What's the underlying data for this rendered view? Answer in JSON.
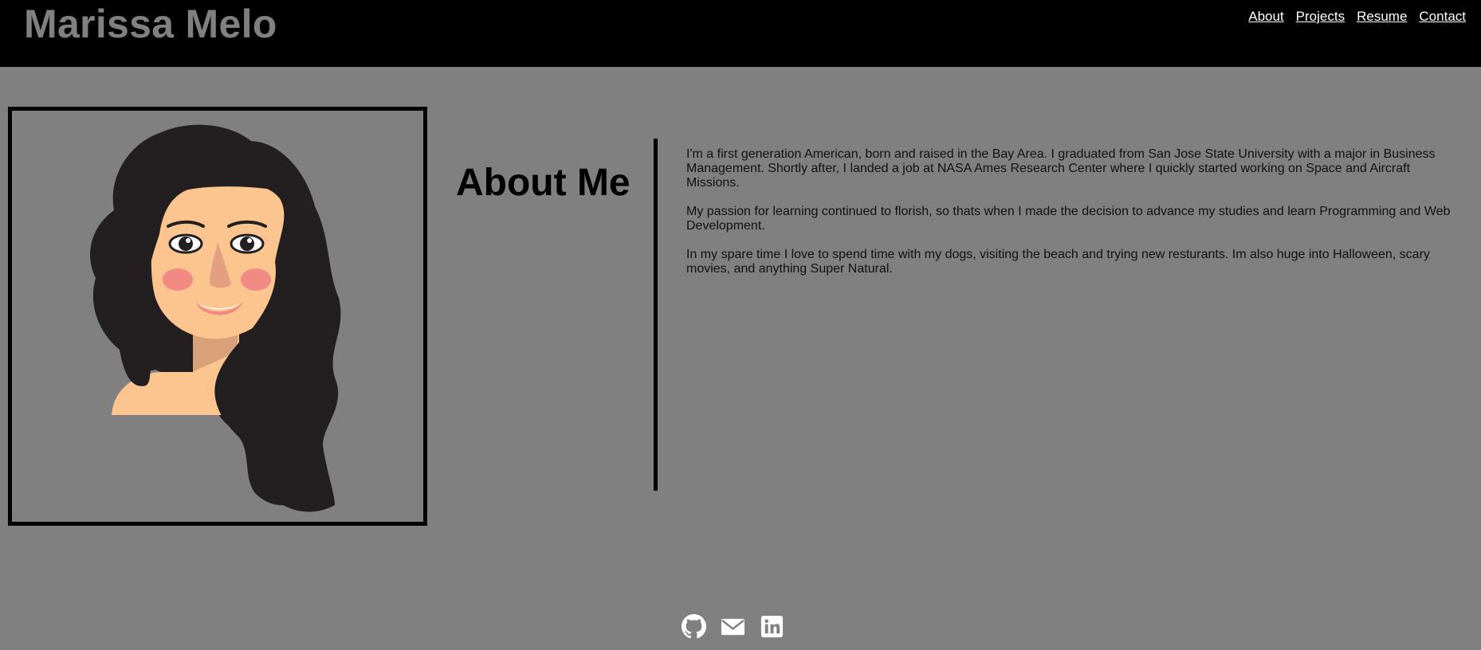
{
  "header": {
    "title": "Marissa Melo",
    "nav": [
      {
        "label": "About"
      },
      {
        "label": "Projects"
      },
      {
        "label": "Resume"
      },
      {
        "label": "Contact"
      }
    ]
  },
  "about": {
    "heading": "About Me",
    "paragraphs": [
      "I'm a first generation American, born and raised in the Bay Area. I graduated from San Jose State University with a major in Business Management. Shortly after, I landed a job at NASA Ames Research Center where I quickly started working on Space and Aircraft Missions.",
      "My passion for learning continued to florish, so thats when I made the decision to advance my studies and learn Programming and Web Development.",
      "In my spare time I love to spend time with my dogs, visiting the beach and trying new resturants. Im also huge into Halloween, scary movies, and anything Super Natural."
    ]
  },
  "footer": {
    "icons": [
      "github-icon",
      "email-icon",
      "linkedin-icon"
    ]
  },
  "colors": {
    "background": "#808080",
    "header": "#000000",
    "title": "#808080",
    "nav_link": "#ffffff",
    "hair": "#231f20",
    "skin": "#fcc590",
    "blush": "#f08a83"
  }
}
